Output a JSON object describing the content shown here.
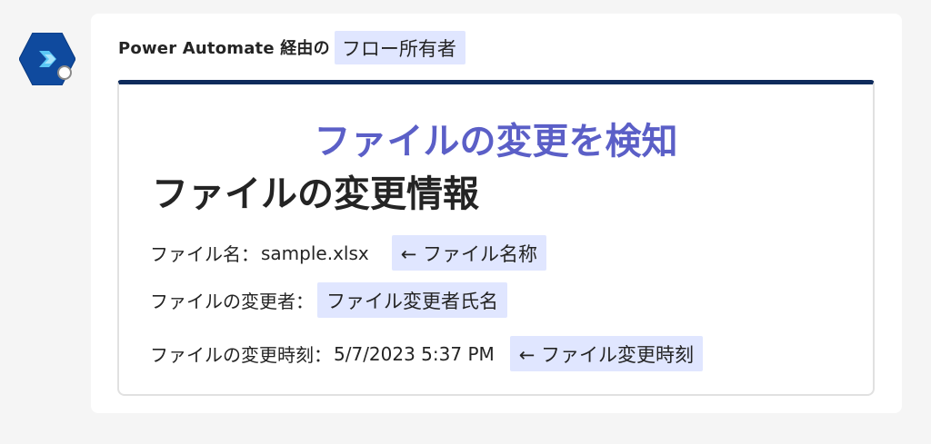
{
  "app": {
    "icon": "power-automate-icon",
    "brand_colors": {
      "hexagon": "#0f4a9e",
      "chevron": "#5bc8f5",
      "card_accent": "#0e2b5c",
      "overlay_title": "#5b5fc7",
      "highlight_bg": "#e0e6ff"
    }
  },
  "message": {
    "sender": "Power Automate 経由の",
    "owner_annotation": "フロー所有者"
  },
  "card": {
    "overlay_title": "ファイルの変更を検知",
    "title": "ファイルの変更情報",
    "facts": [
      {
        "label": "ファイル名：",
        "value": "sample.xlsx",
        "annotation": "← ファイル名称"
      },
      {
        "label": "ファイルの変更者：",
        "value": "",
        "annotation": "ファイル変更者氏名"
      },
      {
        "label": "ファイルの変更時刻：",
        "value": "5/7/2023 5:37 PM",
        "annotation": "← ファイル変更時刻"
      }
    ]
  }
}
